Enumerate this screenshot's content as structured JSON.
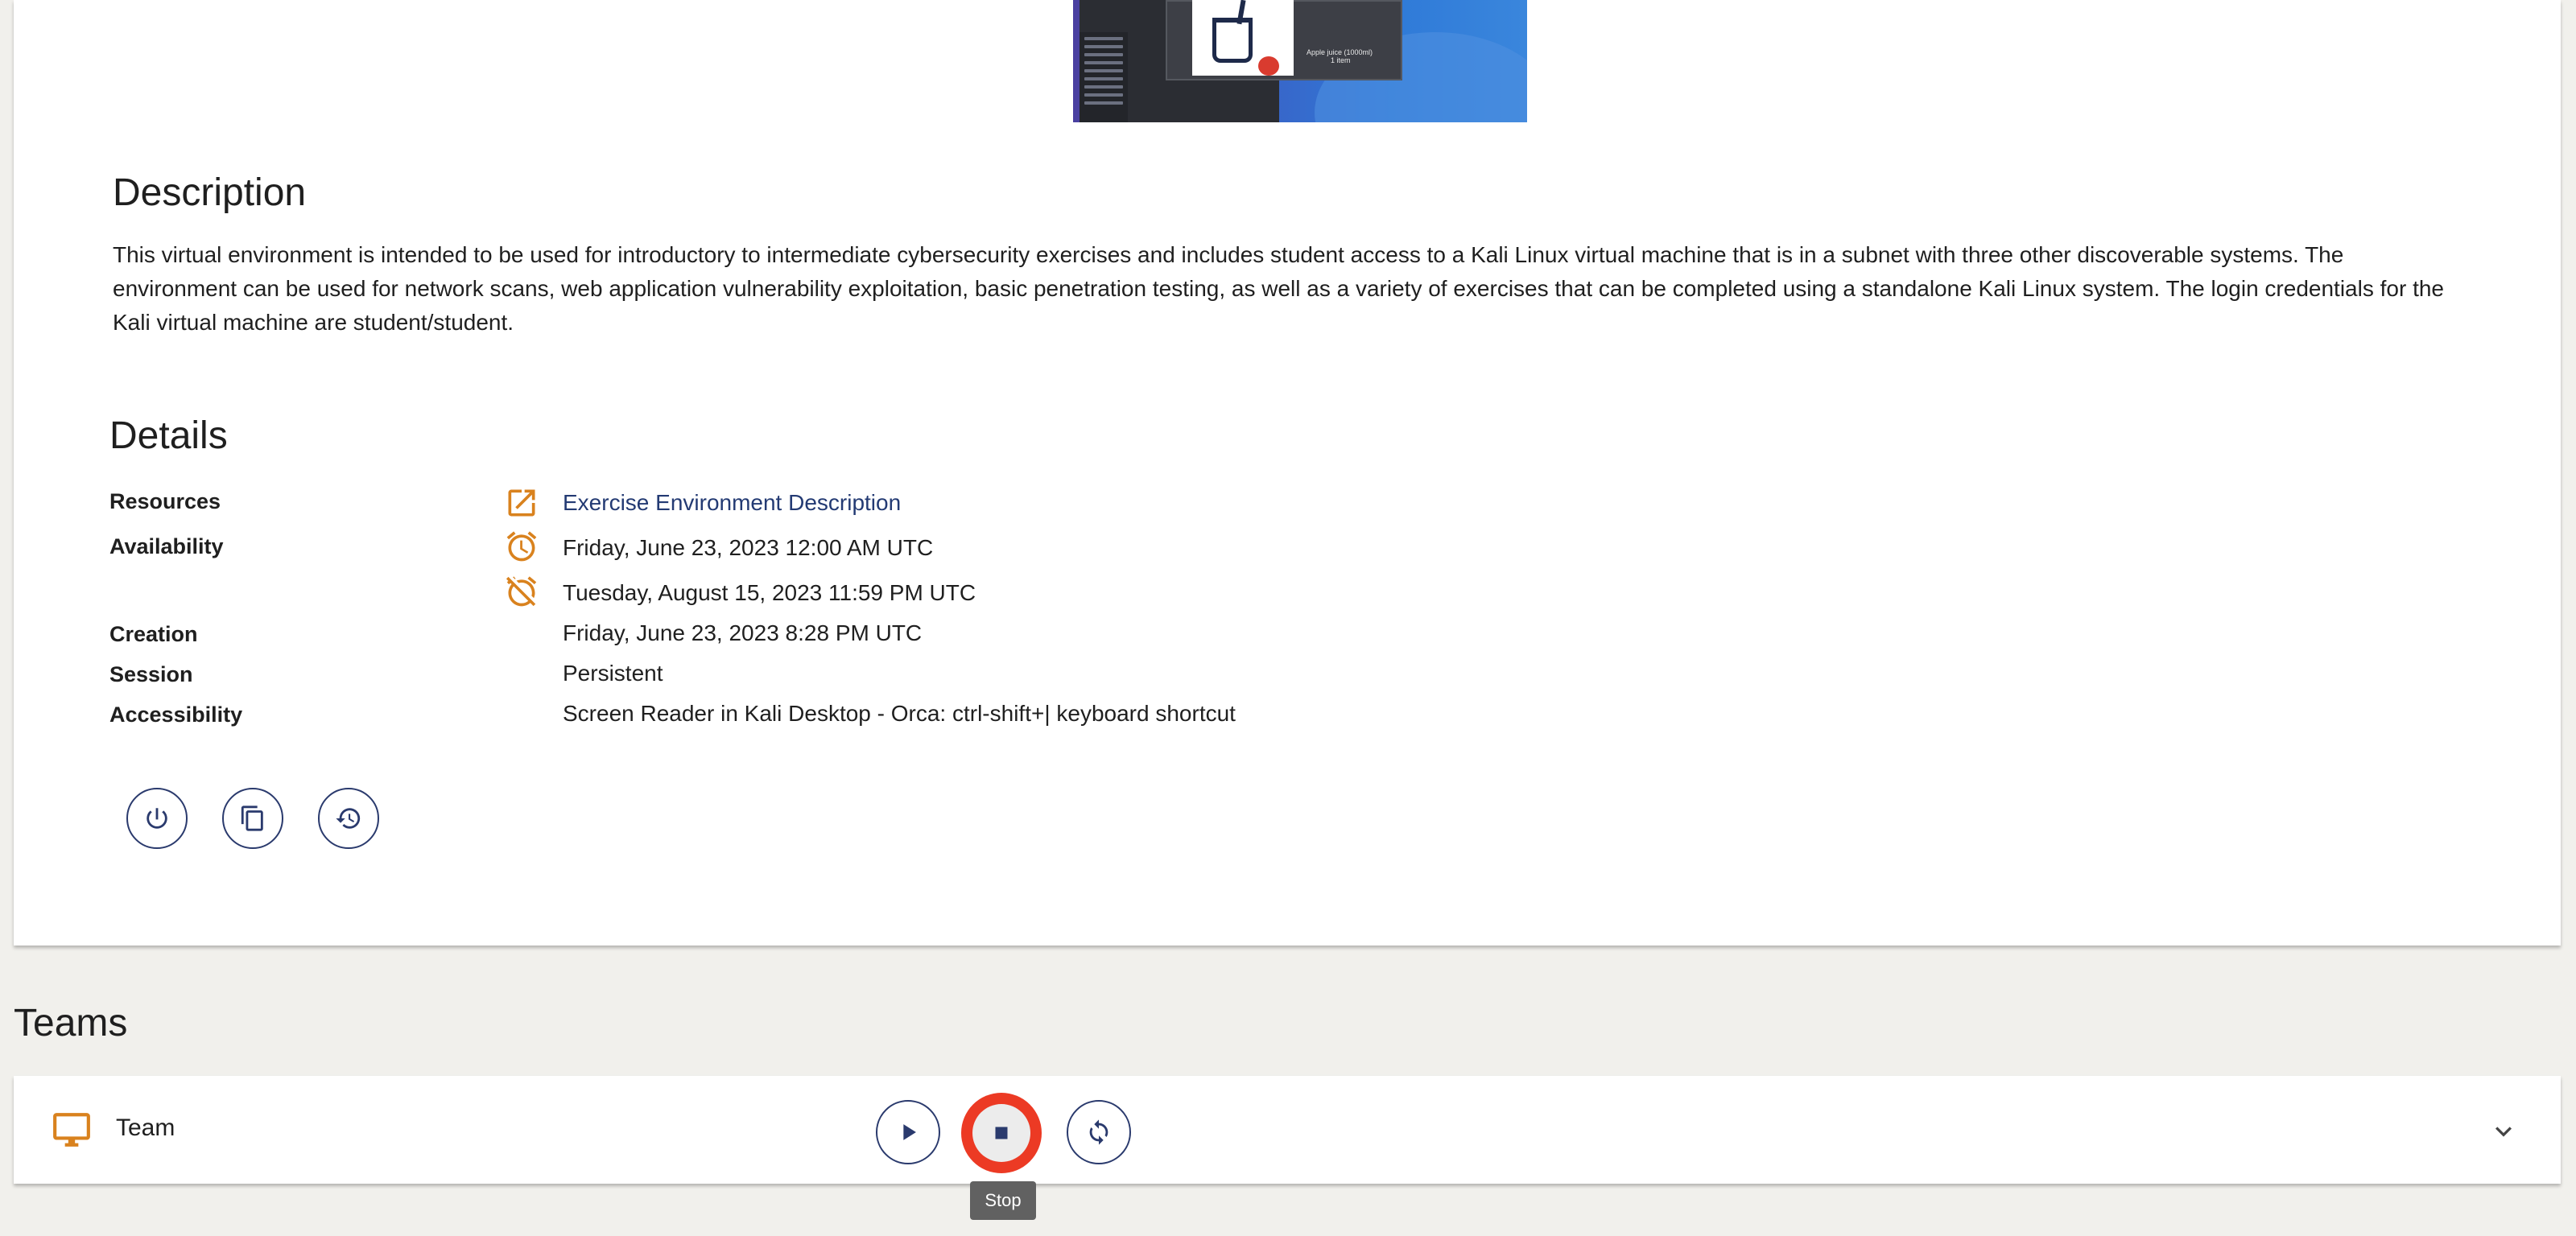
{
  "thumbnail": {
    "caption_line1": "Apple juice (1000ml)",
    "caption_line2": "1 item"
  },
  "description": {
    "heading": "Description",
    "text": "This virtual environment is intended to be used for introductory to intermediate cybersecurity exercises and includes student access to a Kali Linux virtual machine that is in a subnet with three other discoverable systems. The environment can be used for network scans, web application vulnerability exploitation, basic penetration testing, as well as a variety of exercises that can be completed using a standalone Kali Linux system. The login credentials for the Kali virtual machine are student/student."
  },
  "details": {
    "heading": "Details",
    "resources_label": "Resources",
    "resources_link": "Exercise Environment Description",
    "availability_label": "Availability",
    "availability_start": "Friday, June 23, 2023 12:00 AM UTC",
    "availability_end": "Tuesday, August 15, 2023 11:59 PM UTC",
    "creation_label": "Creation",
    "creation_value": "Friday, June 23, 2023 8:28 PM UTC",
    "session_label": "Session",
    "session_value": "Persistent",
    "accessibility_label": "Accessibility",
    "accessibility_value": "Screen Reader in Kali Desktop - Orca: ctrl-shift+| keyboard shortcut"
  },
  "actions": {
    "power_icon": "power-icon",
    "copy_icon": "copy-icon",
    "history_icon": "history-icon"
  },
  "teams": {
    "heading": "Teams",
    "team_name": "Team",
    "tooltip": "Stop"
  },
  "colors": {
    "accent_orange": "#d9821e",
    "navy": "#2a3a6d",
    "link": "#233a73",
    "highlight_red": "#ec3a24",
    "background": "#f1f0ec"
  }
}
